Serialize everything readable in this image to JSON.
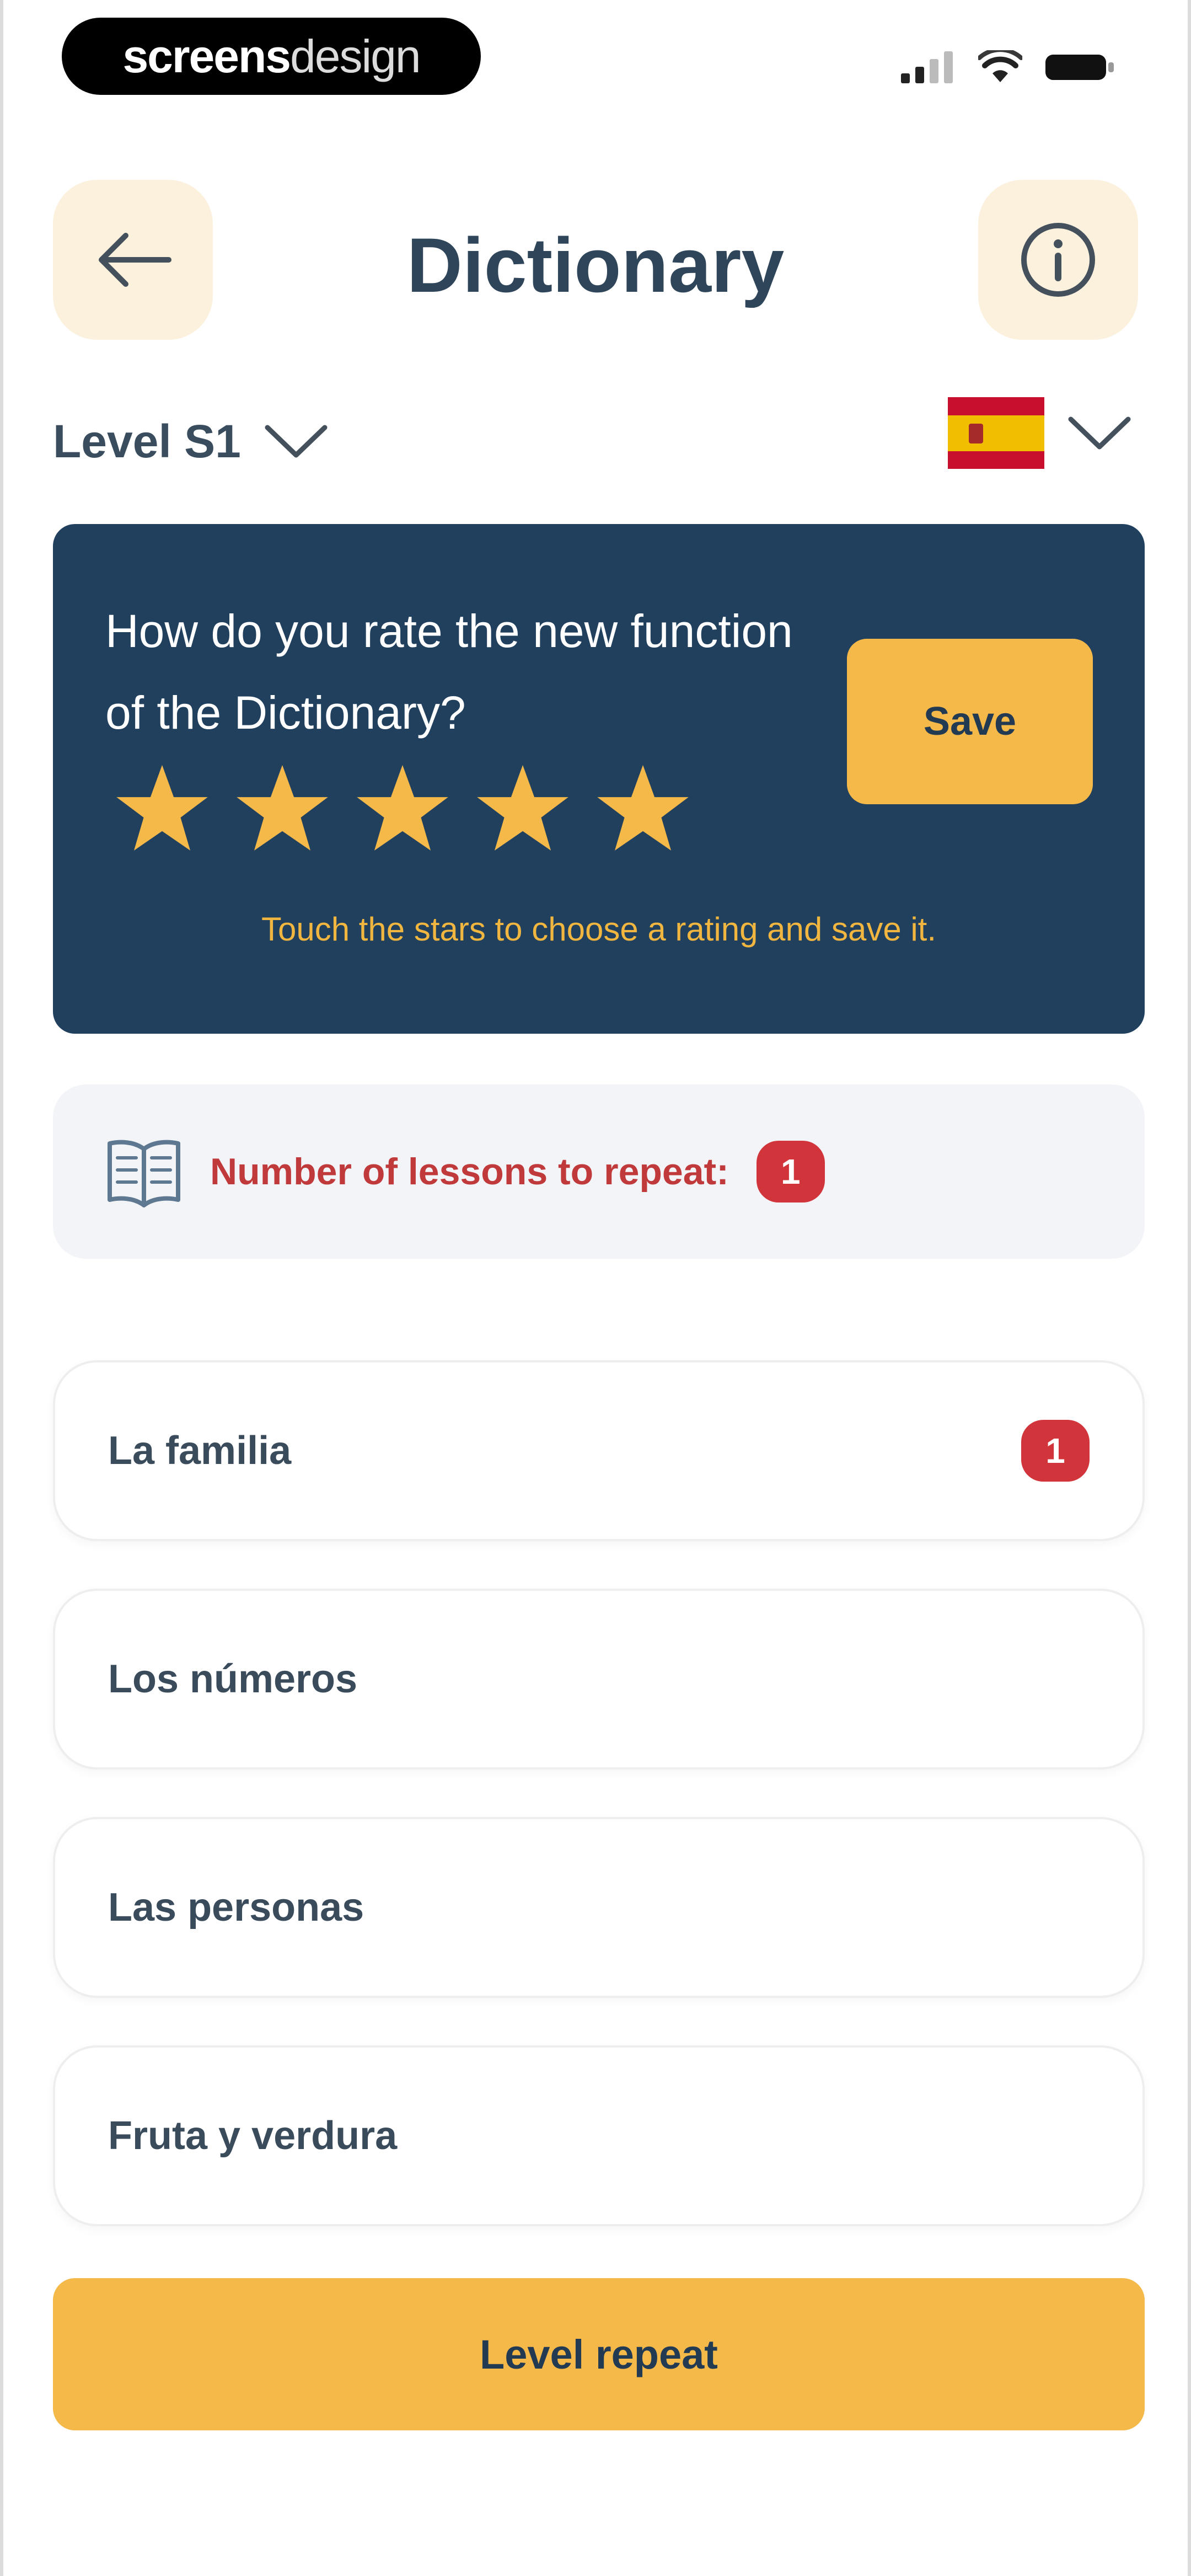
{
  "status_bar": {
    "watermark_bold": "screens",
    "watermark_light": "design"
  },
  "header": {
    "title": "Dictionary",
    "back_icon": "arrow-left-icon",
    "info_icon": "info-icon"
  },
  "level_selector": {
    "label": "Level S1"
  },
  "language_selector": {
    "flag": "spain-flag-icon"
  },
  "rating_card": {
    "question": "How do you rate the new function of the Dictionary?",
    "save_label": "Save",
    "stars": 5,
    "hint": "Touch the stars to choose a rating and save it.",
    "star_color": "#f5b94a",
    "background": "#21405e"
  },
  "repeat_banner": {
    "label": "Number of lessons to repeat:",
    "count": "1",
    "icon": "open-book-icon"
  },
  "lessons": [
    {
      "label": "La familia",
      "badge": "1"
    },
    {
      "label": "Los números",
      "badge": ""
    },
    {
      "label": "Las personas",
      "badge": ""
    },
    {
      "label": "Fruta y verdura",
      "badge": ""
    }
  ],
  "footer": {
    "level_repeat_label": "Level repeat"
  },
  "colors": {
    "accent": "#f5b94a",
    "primary_dark": "#21405e",
    "badge_red": "#d1343a",
    "header_button_bg": "#fbf1dc"
  }
}
